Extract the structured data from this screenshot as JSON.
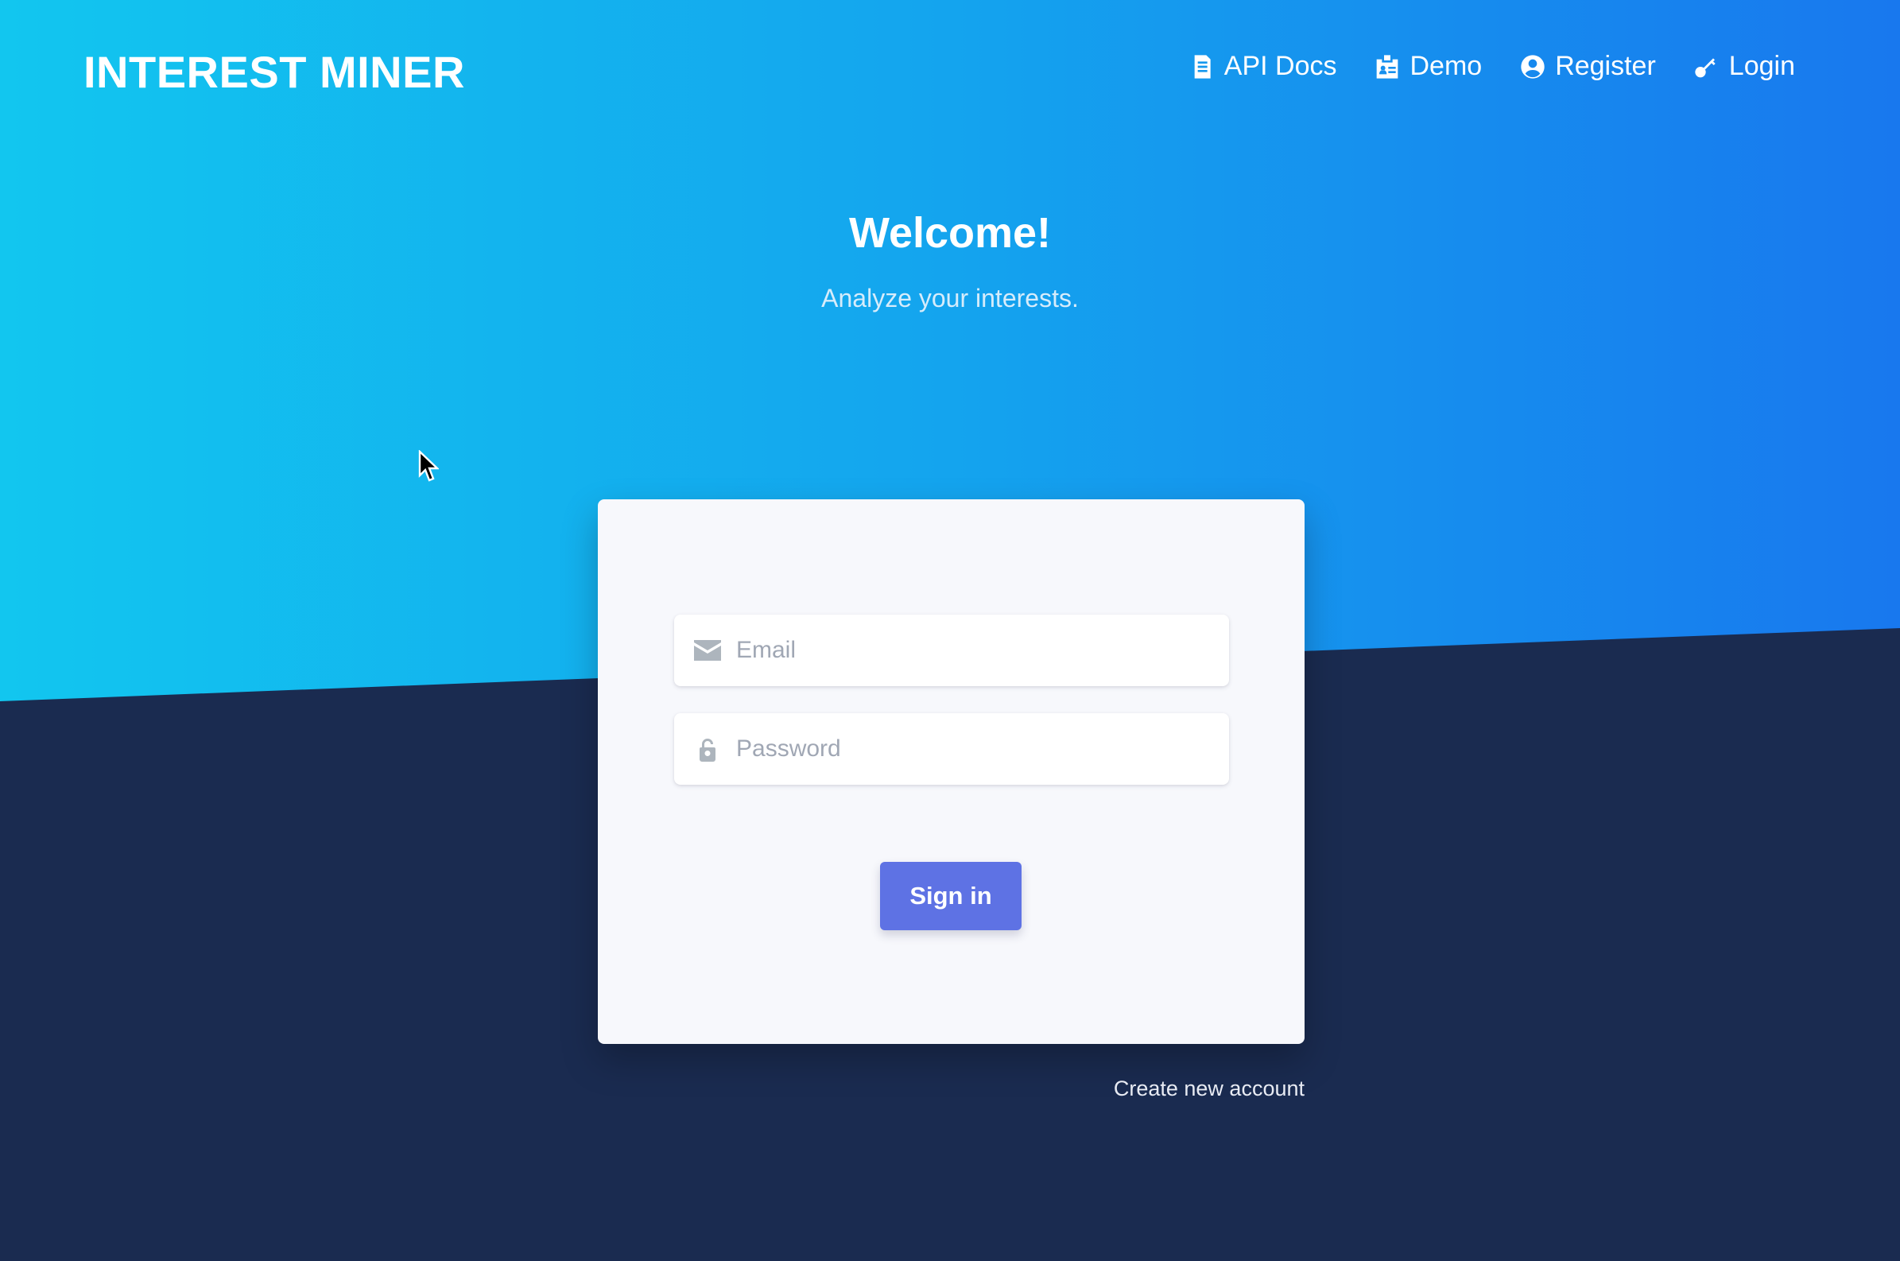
{
  "header": {
    "brand": "INTEREST MINER",
    "nav": [
      {
        "label": "API Docs",
        "icon": "document-icon"
      },
      {
        "label": "Demo",
        "icon": "id-card-icon"
      },
      {
        "label": "Register",
        "icon": "user-circle-icon"
      },
      {
        "label": "Login",
        "icon": "key-icon"
      }
    ]
  },
  "hero": {
    "title": "Welcome!",
    "subtitle": "Analyze your interests."
  },
  "login_form": {
    "email": {
      "placeholder": "Email",
      "value": "",
      "icon": "envelope-icon"
    },
    "password": {
      "placeholder": "Password",
      "value": "",
      "icon": "unlock-icon"
    },
    "submit_label": "Sign in"
  },
  "footer_links": {
    "create_account": "Create new account"
  },
  "colors": {
    "gradient_start": "#12c6ef",
    "gradient_end": "#1878ee",
    "dark_navy": "#1a2b50",
    "primary_button": "#5e72e4",
    "card_bg": "#f7f8fc"
  }
}
